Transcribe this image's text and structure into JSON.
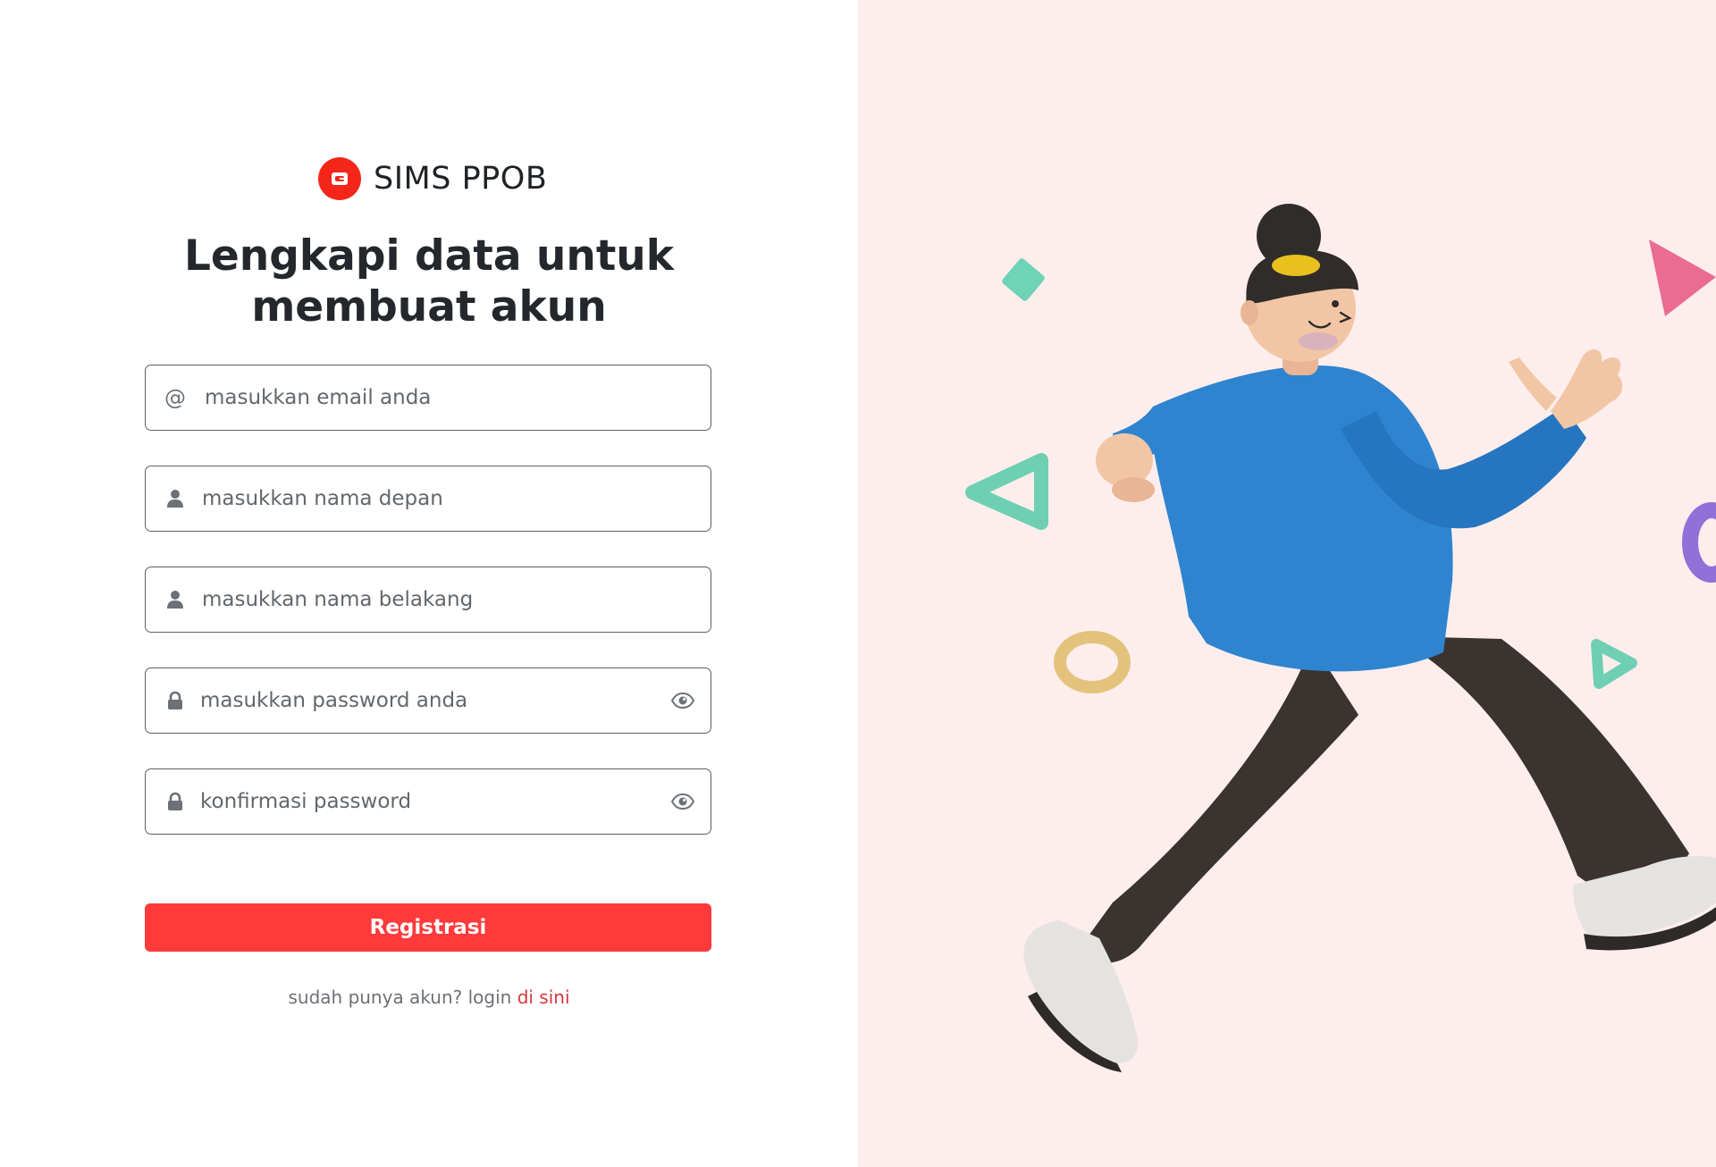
{
  "brand": {
    "name": "SIMS PPOB",
    "icon": "wallet-icon",
    "color": "#f42619"
  },
  "heading": {
    "line1": "Lengkapi data untuk",
    "line2": "membuat akun"
  },
  "form": {
    "email": {
      "placeholder": "masukkan email anda",
      "icon": "at-icon",
      "value": ""
    },
    "first_name": {
      "placeholder": "masukkan nama depan",
      "icon": "user-icon",
      "value": ""
    },
    "last_name": {
      "placeholder": "masukkan nama belakang",
      "icon": "user-icon",
      "value": ""
    },
    "password": {
      "placeholder": "masukkan password anda",
      "icon": "lock-icon",
      "toggle_icon": "eye-icon",
      "value": ""
    },
    "confirm_password": {
      "placeholder": "konfirmasi password",
      "icon": "lock-icon",
      "toggle_icon": "eye-icon",
      "value": ""
    },
    "submit_label": "Registrasi",
    "submit_color": "#fe3a3b"
  },
  "footer": {
    "prompt": "sudah punya akun? login ",
    "link_label": "di sini",
    "link_color": "#d9363e"
  },
  "illustration": {
    "description_icon": "walking-person-illustration",
    "background": "#fdeeed"
  }
}
